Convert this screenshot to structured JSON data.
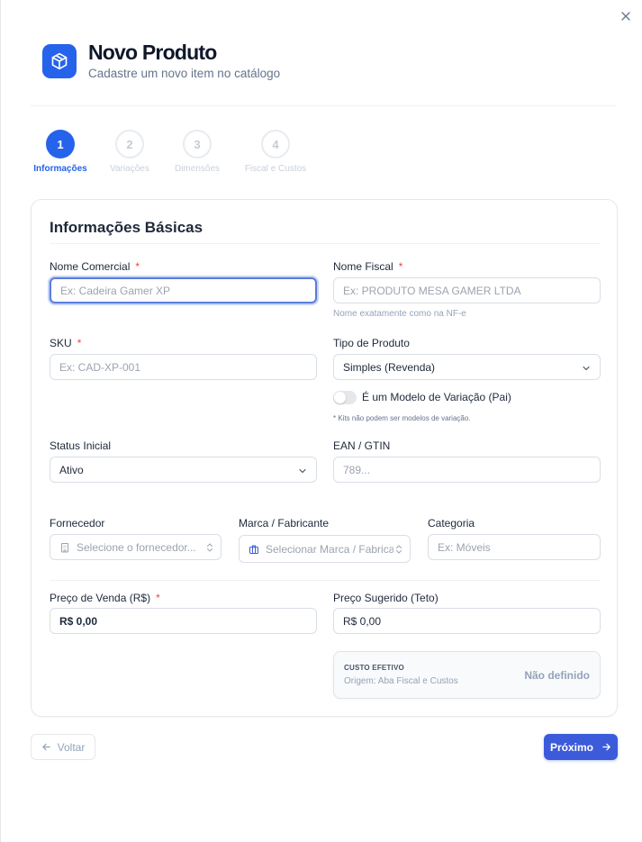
{
  "header": {
    "title": "Novo Produto",
    "subtitle": "Cadastre um novo item no catálogo",
    "brand_color": "#2563eb",
    "logo_icon": "package-icon",
    "close_icon": "close-icon"
  },
  "stepper": {
    "steps": [
      {
        "number": "1",
        "label": "Informações",
        "state": "active"
      },
      {
        "number": "2",
        "label": "Variações",
        "state": "inactive"
      },
      {
        "number": "3",
        "label": "Dimensões",
        "state": "inactive"
      },
      {
        "number": "4",
        "label": "Fiscal e Custos",
        "state": "inactive"
      }
    ]
  },
  "form": {
    "section_title": "Informações Básicas",
    "required_mark": "*",
    "nome_comercial": {
      "label": "Nome Comercial",
      "placeholder": "Ex: Cadeira Gamer XP"
    },
    "nome_fiscal": {
      "label": "Nome Fiscal",
      "placeholder": "Ex: PRODUTO MESA GAMER LTDA",
      "hint": "Nome exatamente como na NF-e"
    },
    "sku": {
      "label": "SKU",
      "placeholder": "Ex: CAD-XP-001"
    },
    "tipo_produto": {
      "label": "Tipo de Produto",
      "value": "Simples (Revenda)"
    },
    "modelo_variacao": {
      "label": "É um Modelo de Variação (Pai)",
      "checked": false,
      "hint": "* Kits não podem ser modelos de variação."
    },
    "status_inicial": {
      "label": "Status Inicial",
      "value": "Ativo"
    },
    "ean": {
      "label": "EAN / GTIN",
      "placeholder": "789..."
    },
    "fornecedor": {
      "label": "Fornecedor",
      "placeholder": "Selecione o fornecedor..."
    },
    "marca": {
      "label": "Marca / Fabricante",
      "placeholder": "Selecionar Marca / Fabricante"
    },
    "categoria": {
      "label": "Categoria",
      "placeholder": "Ex: Móveis"
    },
    "preco_venda": {
      "label": "Preço de Venda (R$)",
      "value": "R$ 0,00"
    },
    "preco_sugerido": {
      "label": "Preço Sugerido (Teto)",
      "value": "R$ 0,00"
    },
    "custo_efetivo": {
      "title": "CUSTO EFETIVO",
      "origin": "Origem: Aba Fiscal e Custos",
      "value": "Não definido"
    }
  },
  "footer": {
    "back_label": "Voltar",
    "next_label": "Próximo"
  }
}
